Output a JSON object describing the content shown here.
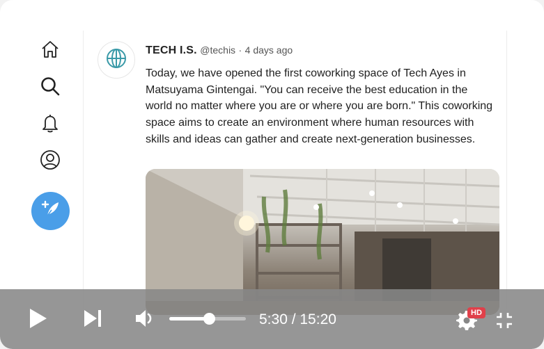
{
  "sidebar": {
    "icons": [
      "home-icon",
      "search-icon",
      "bell-icon",
      "profile-icon"
    ],
    "compose_icon": "feather-plus-icon",
    "accent": "#4a9ee8"
  },
  "tweet": {
    "name": "TECH I.S.",
    "handle": "@techis",
    "separator": "·",
    "time": "4 days ago",
    "text": "Today, we have opened the first coworking space of Tech Ayes in Matsuyama Gintengai. \"You can receive the best education in the world no matter where you are or where you are born.\" This coworking space aims to create an environment where human resources with skills and ideas can gather and create next-generation businesses."
  },
  "player": {
    "timecode": "5:30 / 15:20",
    "volume_level": 0.52,
    "quality_badge": "HD",
    "icons": [
      "play-icon",
      "skip-next-icon",
      "volume-icon",
      "settings-icon",
      "exit-fullscreen-icon"
    ]
  }
}
